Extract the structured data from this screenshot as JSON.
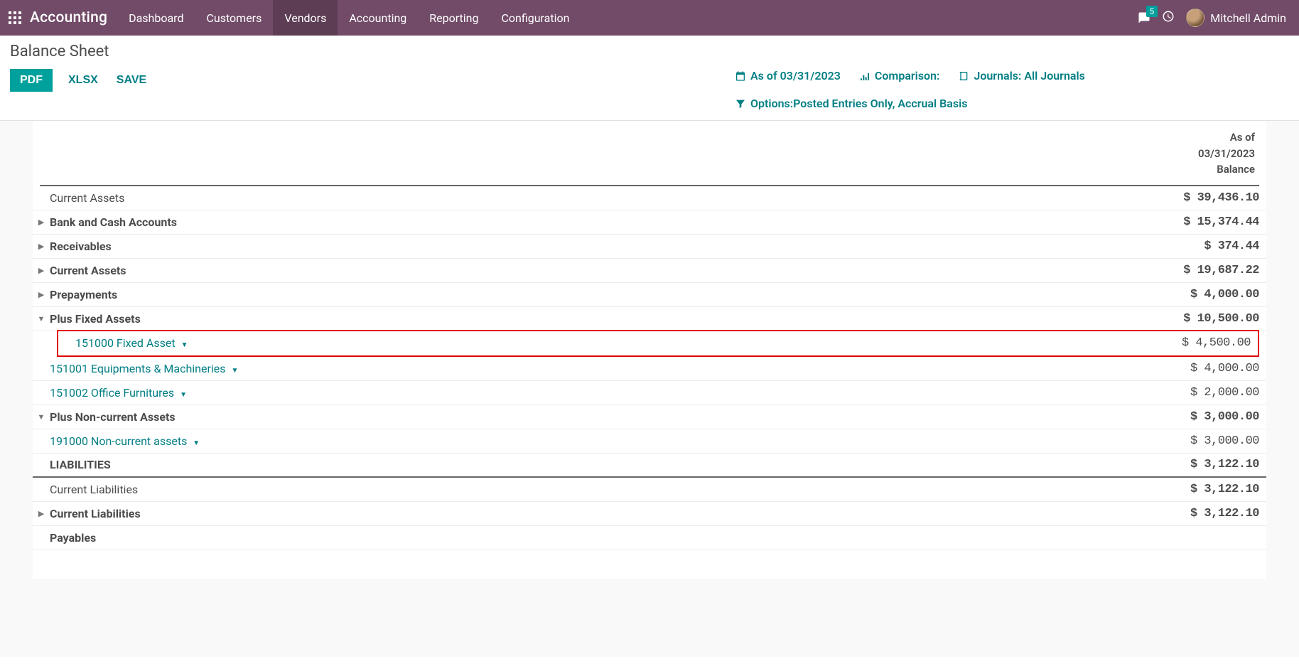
{
  "nav": {
    "brand": "Accounting",
    "items": [
      "Dashboard",
      "Customers",
      "Vendors",
      "Accounting",
      "Reporting",
      "Configuration"
    ],
    "active_index": 2,
    "msg_count": "5",
    "user_name": "Mitchell Admin"
  },
  "cp": {
    "title": "Balance Sheet",
    "btn_pdf": "PDF",
    "btn_xlsx": "XLSX",
    "btn_save": "SAVE",
    "filter_asof": "As of 03/31/2023",
    "filter_comparison": "Comparison:",
    "filter_journals": "Journals: All Journals",
    "filter_options": "Options:Posted Entries Only, Accrual Basis"
  },
  "header": {
    "line1": "As of",
    "line2": "03/31/2023",
    "line3": "Balance"
  },
  "rows": [
    {
      "type": "plain",
      "level": 1,
      "caret": "",
      "label": "Current Assets",
      "amount": "$ 39,436.10",
      "bold": false
    },
    {
      "type": "plain",
      "level": 2,
      "caret": "right",
      "label": "Bank and Cash Accounts",
      "amount": "$ 15,374.44",
      "bold": true
    },
    {
      "type": "plain",
      "level": 2,
      "caret": "right",
      "label": "Receivables",
      "amount": "$ 374.44",
      "bold": true
    },
    {
      "type": "plain",
      "level": 2,
      "caret": "right",
      "label": "Current Assets",
      "amount": "$ 19,687.22",
      "bold": true
    },
    {
      "type": "plain",
      "level": 2,
      "caret": "right",
      "label": "Prepayments",
      "amount": "$ 4,000.00",
      "bold": true
    },
    {
      "type": "plain",
      "level": 1,
      "caret": "down",
      "label": "Plus Fixed Assets",
      "amount": "$ 10,500.00",
      "bold": true
    },
    {
      "type": "account",
      "level": 3,
      "caret": "",
      "label": "151000 Fixed Asset",
      "amount": "$ 4,500.00",
      "highlight": true
    },
    {
      "type": "account",
      "level": 3,
      "caret": "",
      "label": "151001 Equipments & Machineries",
      "amount": "$ 4,000.00"
    },
    {
      "type": "account",
      "level": 3,
      "caret": "",
      "label": "151002 Office Furnitures",
      "amount": "$ 2,000.00"
    },
    {
      "type": "plain",
      "level": 1,
      "caret": "down",
      "label": "Plus Non-current Assets",
      "amount": "$ 3,000.00",
      "bold": true
    },
    {
      "type": "account",
      "level": 3,
      "caret": "",
      "label": "191000 Non-current assets",
      "amount": "$ 3,000.00"
    },
    {
      "type": "section",
      "level": 0,
      "caret": "",
      "label": "LIABILITIES",
      "amount": "$ 3,122.10",
      "bold": true,
      "divider_after": true
    },
    {
      "type": "plain",
      "level": 1,
      "caret": "",
      "label": "Current Liabilities",
      "amount": "$ 3,122.10"
    },
    {
      "type": "plain",
      "level": 2,
      "caret": "right",
      "label": "Current Liabilities",
      "amount": "$ 3,122.10",
      "bold": true
    },
    {
      "type": "plain",
      "level": 2,
      "caret": "",
      "label": "Payables",
      "amount": "",
      "bold": true
    }
  ]
}
